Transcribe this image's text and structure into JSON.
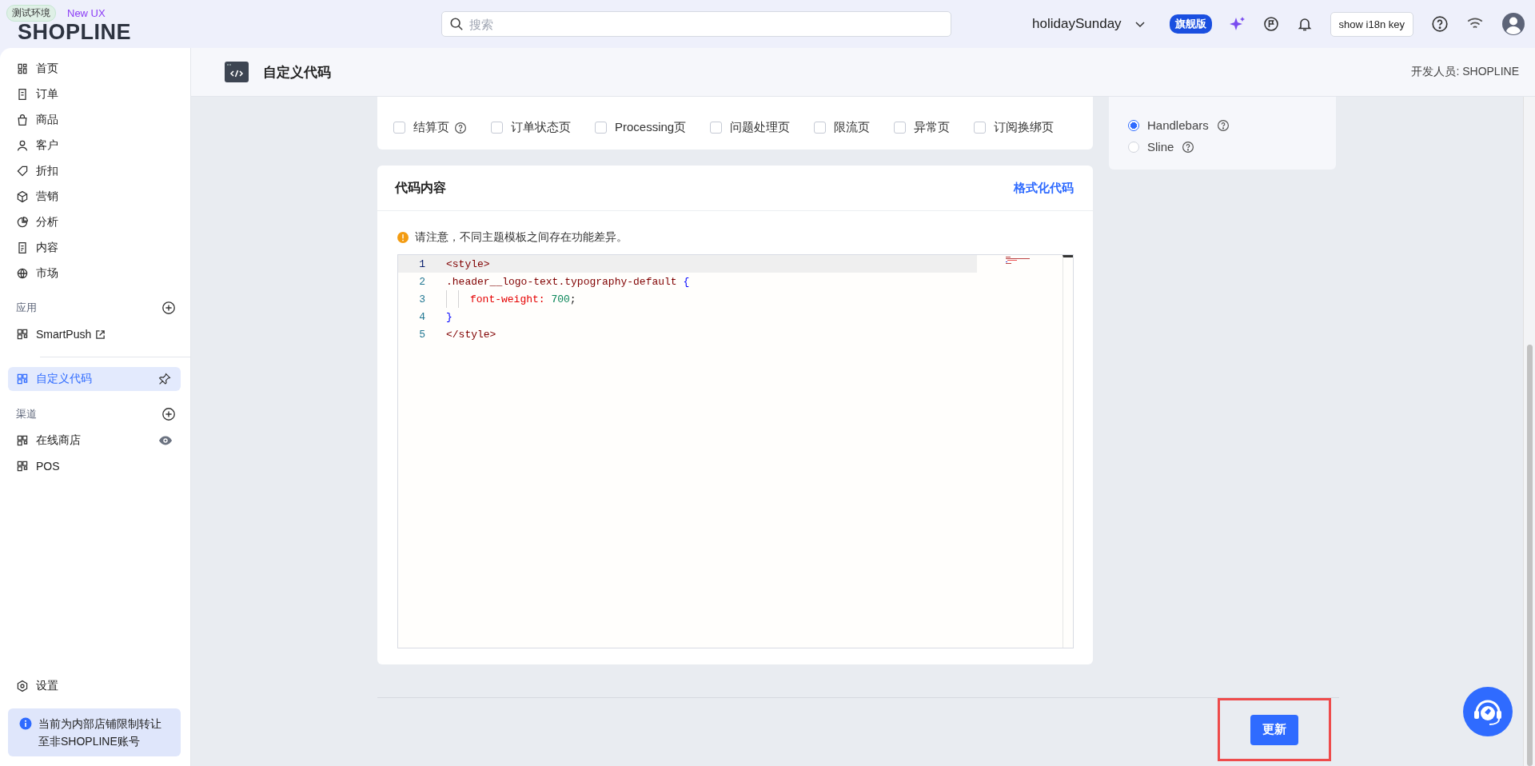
{
  "top_bar": {
    "environment_tag": "测试环境",
    "ux_tag": "New UX",
    "logo": "SHOPLINE",
    "search": {
      "placeholder": "搜索"
    },
    "store_name": "holidaySunday",
    "plan_badge": "旗舰版",
    "i18n_button": "show i18n key"
  },
  "sidebar": {
    "groups": [
      {
        "items": [
          {
            "label": "首页",
            "selected": false
          },
          {
            "label": "订单",
            "selected": false
          },
          {
            "label": "商品",
            "selected": false
          },
          {
            "label": "客户",
            "selected": false
          },
          {
            "label": "折扣",
            "selected": false
          },
          {
            "label": "营销",
            "selected": false
          },
          {
            "label": "分析",
            "selected": false
          },
          {
            "label": "内容",
            "selected": false
          },
          {
            "label": "市场",
            "selected": false
          }
        ]
      },
      {
        "title": "应用",
        "items": [
          {
            "label": "SmartPush",
            "selected": false
          }
        ]
      },
      {
        "items": [
          {
            "label": "自定义代码",
            "selected": true
          }
        ]
      },
      {
        "title": "渠道",
        "items": [
          {
            "label": "在线商店",
            "selected": false
          },
          {
            "label": "POS",
            "selected": false
          }
        ]
      }
    ],
    "settings": "设置",
    "notice": "当前为内部店铺限制转让至非SHOPLINE账号"
  },
  "page_header": {
    "title": "自定义代码",
    "developer": "开发人员: SHOPLINE"
  },
  "checkout_pages": {
    "options": [
      {
        "label": "结算页",
        "checked": false,
        "help": true
      },
      {
        "label": "订单状态页",
        "checked": false,
        "help": false
      },
      {
        "label": "Processing页",
        "checked": false,
        "help": false
      },
      {
        "label": "问题处理页",
        "checked": false,
        "help": false
      },
      {
        "label": "限流页",
        "checked": false,
        "help": false
      },
      {
        "label": "异常页",
        "checked": false,
        "help": false
      },
      {
        "label": "订阅换绑页",
        "checked": false,
        "help": false
      }
    ]
  },
  "code_card": {
    "title": "代码内容",
    "format_link": "格式化代码",
    "warning": "请注意，不同主题模板之间存在功能差异。",
    "lines": [
      {
        "number": "1",
        "active": true,
        "indented": false,
        "tokens": [
          {
            "kind": "tag",
            "text": "<style>"
          }
        ]
      },
      {
        "number": "2",
        "active": false,
        "indented": false,
        "tokens": [
          {
            "kind": "selector",
            "text": ".header__logo-text.typography-default "
          },
          {
            "kind": "brace",
            "text": "{"
          }
        ]
      },
      {
        "number": "3",
        "active": false,
        "indented": true,
        "tokens": [
          {
            "kind": "property",
            "text": "font-weight: "
          },
          {
            "kind": "number",
            "text": "700"
          },
          {
            "kind": "plain",
            "text": ";"
          }
        ]
      },
      {
        "number": "4",
        "active": false,
        "indented": false,
        "tokens": [
          {
            "kind": "brace",
            "text": "}"
          }
        ]
      },
      {
        "number": "5",
        "active": false,
        "indented": false,
        "tokens": [
          {
            "kind": "tag",
            "text": "</style>"
          }
        ]
      }
    ]
  },
  "theme_language": {
    "options": [
      {
        "label": "Handlebars",
        "selected": true
      },
      {
        "label": "Sline",
        "selected": false
      }
    ]
  },
  "footer": {
    "update_button": "更新"
  }
}
